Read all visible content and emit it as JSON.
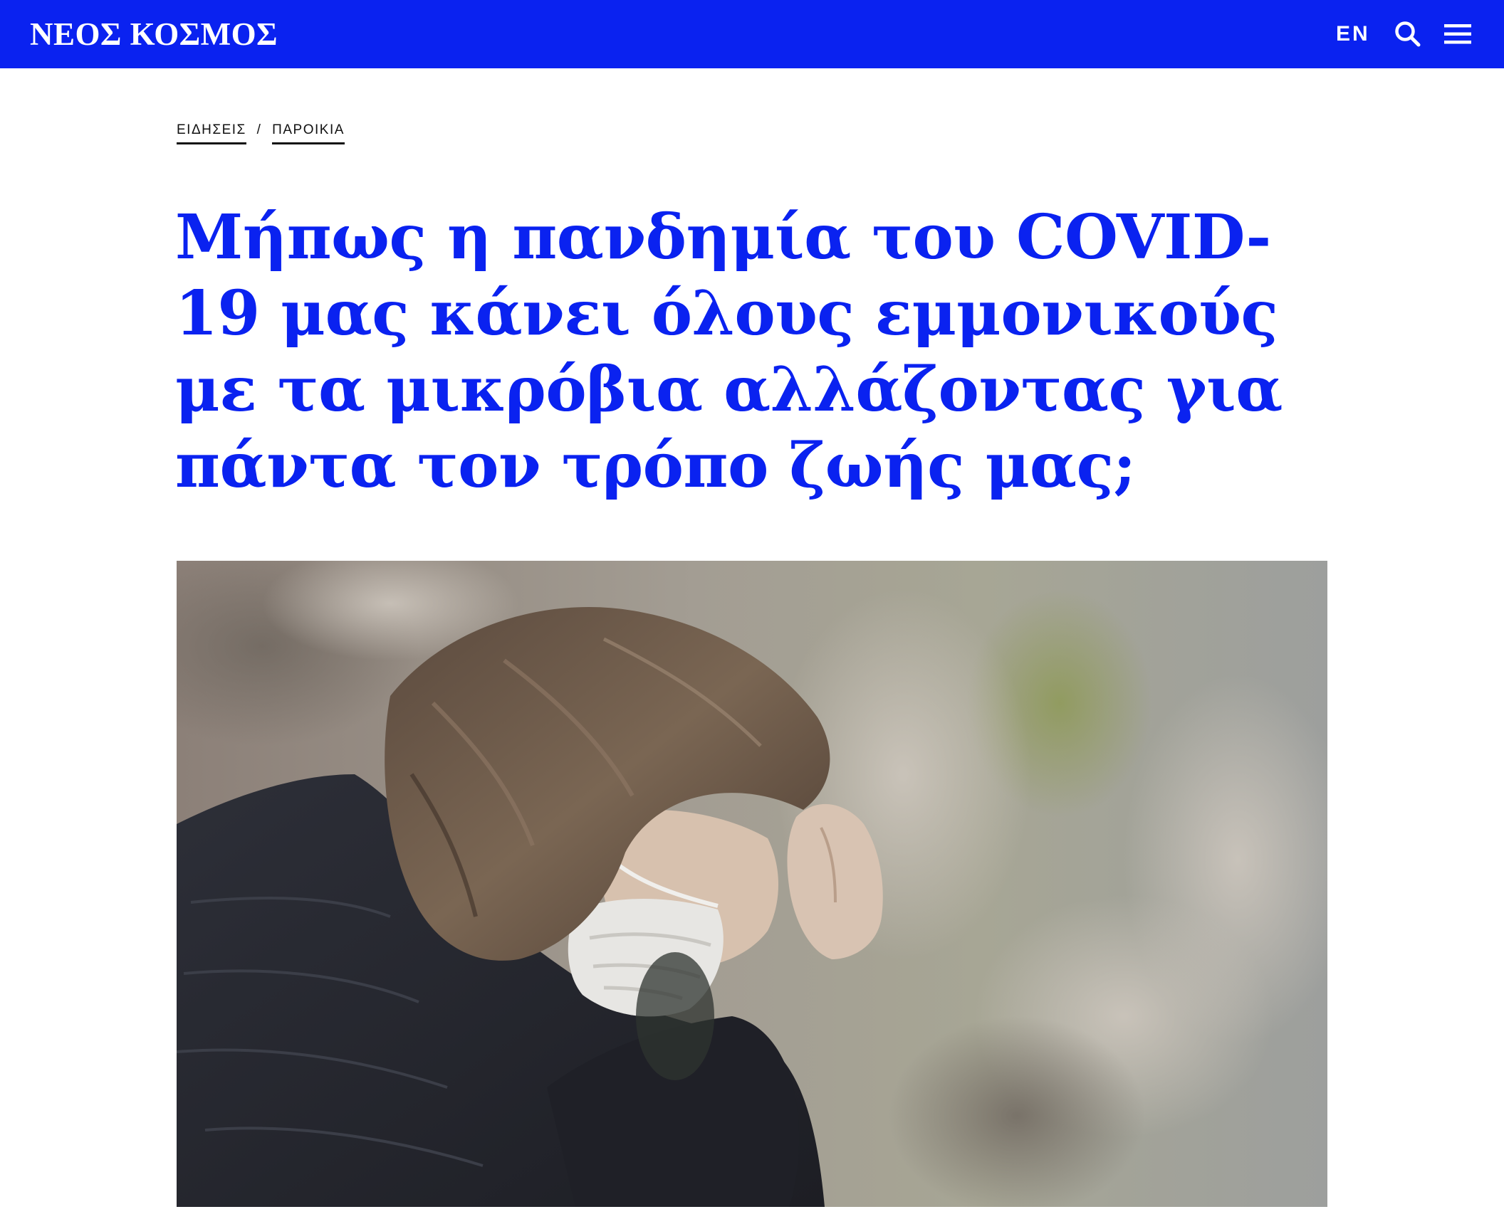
{
  "header": {
    "logo": "ΝΕΟΣ ΚΟΣΜΟΣ",
    "lang_label": "EN",
    "search_icon": "search-icon",
    "menu_icon": "hamburger-menu-icon",
    "background_color": "#0a22f0"
  },
  "breadcrumb": {
    "items": [
      {
        "label": "ΕΙΔΗΣΕΙΣ"
      },
      {
        "label": "ΠΑΡΟΙΚΙΑ"
      }
    ],
    "separator": "/"
  },
  "article": {
    "title": "Μήπως η πανδημία του COVID-19 μας κάνει όλους εμμονικούς με τα μικρόβια αλλάζοντας για πάντα τον τρόπο ζωής μας;",
    "title_color": "#0a22f0"
  }
}
